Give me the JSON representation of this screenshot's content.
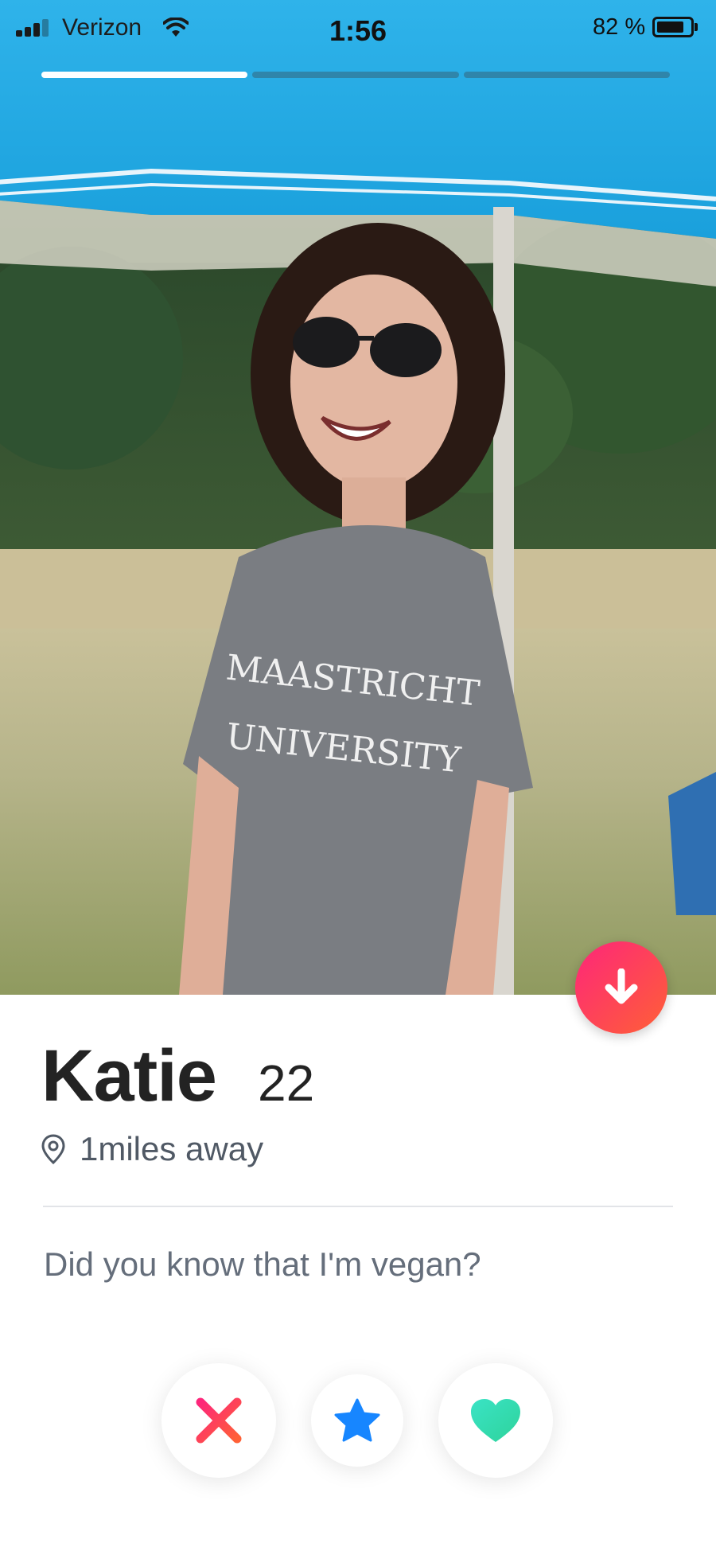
{
  "status_bar": {
    "carrier": "Verizon",
    "time": "1:56",
    "battery_percent_label": "82 %",
    "battery_level": 0.82
  },
  "stories": {
    "segments": 3,
    "active_index": 0
  },
  "profile": {
    "name": "Katie",
    "age": "22",
    "distance": "1miles away",
    "bio": "Did you know that I'm vegan?",
    "photo_shirt_text_line1": "MAASTRICHT",
    "photo_shirt_text_line2": "UNIVERSITY"
  },
  "actions": {
    "nope_icon": "close-x-icon",
    "super_like_icon": "star-icon",
    "like_icon": "heart-icon"
  },
  "colors": {
    "brand_gradient_start": "#fd267a",
    "brand_gradient_end": "#ff6036",
    "super_like": "#1786ff",
    "like": "#2ee6b0",
    "nope_start": "#fd267a",
    "nope_end": "#ff6036"
  }
}
